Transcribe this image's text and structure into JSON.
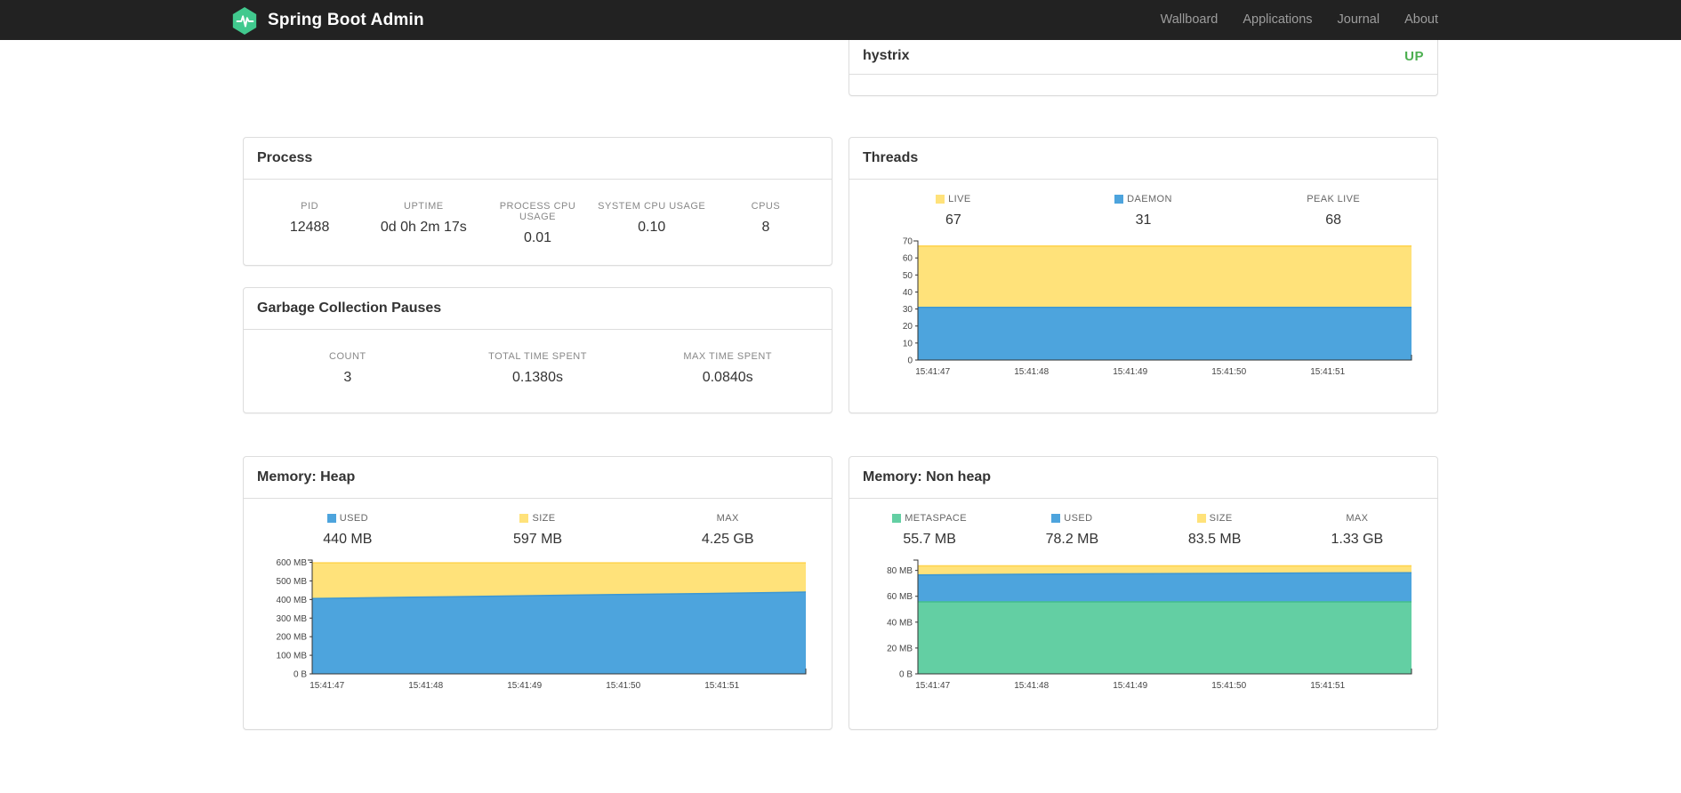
{
  "navbar": {
    "brand": "Spring Boot Admin",
    "items": [
      {
        "label": "Wallboard"
      },
      {
        "label": "Applications"
      },
      {
        "label": "Journal"
      },
      {
        "label": "About"
      }
    ]
  },
  "status_panel": {
    "row_label": "hystrix",
    "row_status": "UP"
  },
  "process": {
    "title": "Process",
    "metrics": [
      {
        "label": "PID",
        "value": "12488"
      },
      {
        "label": "UPTIME",
        "value": "0d 0h 2m 17s"
      },
      {
        "label": "PROCESS CPU USAGE",
        "value": "0.01"
      },
      {
        "label": "SYSTEM CPU USAGE",
        "value": "0.10"
      },
      {
        "label": "CPUS",
        "value": "8"
      }
    ]
  },
  "gc": {
    "title": "Garbage Collection Pauses",
    "metrics": [
      {
        "label": "COUNT",
        "value": "3"
      },
      {
        "label": "TOTAL TIME SPENT",
        "value": "0.1380s"
      },
      {
        "label": "MAX TIME SPENT",
        "value": "0.0840s"
      }
    ]
  },
  "threads": {
    "title": "Threads",
    "legend": [
      {
        "label": "LIVE",
        "value": "67",
        "color": "#FFE27A"
      },
      {
        "label": "DAEMON",
        "value": "31",
        "color": "#4DA4DD"
      },
      {
        "label": "PEAK LIVE",
        "value": "68"
      }
    ]
  },
  "memory_heap": {
    "title": "Memory: Heap",
    "legend": [
      {
        "label": "USED",
        "value": "440 MB",
        "color": "#4DA4DD"
      },
      {
        "label": "SIZE",
        "value": "597 MB",
        "color": "#FFE27A"
      },
      {
        "label": "MAX",
        "value": "4.25 GB"
      }
    ]
  },
  "memory_nonheap": {
    "title": "Memory: Non heap",
    "legend": [
      {
        "label": "METASPACE",
        "value": "55.7 MB",
        "color": "#63CFA3"
      },
      {
        "label": "USED",
        "value": "78.2 MB",
        "color": "#4DA4DD"
      },
      {
        "label": "SIZE",
        "value": "83.5 MB",
        "color": "#FFE27A"
      },
      {
        "label": "MAX",
        "value": "1.33 GB"
      }
    ]
  },
  "colors": {
    "navbar_bg": "#222222",
    "logo_green": "#41C98E",
    "status_up": "#4CAF50",
    "series_yellow": "#FFE27A",
    "series_blue": "#4DA4DD",
    "series_green": "#63CFA3"
  },
  "chart_data": [
    {
      "type": "area",
      "title": "Threads",
      "legend_position": "top",
      "x": [
        "15:41:47",
        "15:41:48",
        "15:41:49",
        "15:41:50",
        "15:41:51"
      ],
      "ylim": [
        0,
        70
      ],
      "y_ticks": [
        {
          "v": 0,
          "t": "0"
        },
        {
          "v": 10,
          "t": "10"
        },
        {
          "v": 20,
          "t": "20"
        },
        {
          "v": 30,
          "t": "30"
        },
        {
          "v": 40,
          "t": "40"
        },
        {
          "v": 50,
          "t": "50"
        },
        {
          "v": 60,
          "t": "60"
        },
        {
          "v": 70,
          "t": "70"
        }
      ],
      "series": [
        {
          "name": "LIVE",
          "color": "#FFE27A",
          "stroke": "#FFD34D",
          "values": [
            67,
            67,
            67,
            67,
            67,
            67
          ]
        },
        {
          "name": "DAEMON",
          "color": "#4DA4DD",
          "stroke": "#3C97D3",
          "values": [
            31,
            31,
            31,
            31,
            31,
            31
          ]
        }
      ]
    },
    {
      "type": "area",
      "title": "Memory: Heap",
      "legend_position": "top",
      "x": [
        "15:41:47",
        "15:41:48",
        "15:41:49",
        "15:41:50",
        "15:41:51"
      ],
      "ylim": [
        0,
        612
      ],
      "y_ticks": [
        {
          "v": 0,
          "t": "0 B"
        },
        {
          "v": 100,
          "t": "100 MB"
        },
        {
          "v": 200,
          "t": "200 MB"
        },
        {
          "v": 300,
          "t": "300 MB"
        },
        {
          "v": 400,
          "t": "400 MB"
        },
        {
          "v": 500,
          "t": "500 MB"
        },
        {
          "v": 600,
          "t": "600 MB"
        }
      ],
      "series": [
        {
          "name": "SIZE",
          "color": "#FFE27A",
          "stroke": "#FFD34D",
          "values": [
            597,
            597,
            597,
            597,
            597,
            597
          ]
        },
        {
          "name": "USED",
          "color": "#4DA4DD",
          "stroke": "#3C97D3",
          "values": [
            405,
            412,
            419,
            426,
            432,
            440
          ]
        }
      ]
    },
    {
      "type": "area",
      "title": "Memory: Non heap",
      "legend_position": "top",
      "x": [
        "15:41:47",
        "15:41:48",
        "15:41:49",
        "15:41:50",
        "15:41:51"
      ],
      "ylim": [
        0,
        88
      ],
      "y_ticks": [
        {
          "v": 0,
          "t": "0 B"
        },
        {
          "v": 20,
          "t": "20 MB"
        },
        {
          "v": 40,
          "t": "40 MB"
        },
        {
          "v": 60,
          "t": "60 MB"
        },
        {
          "v": 80,
          "t": "80 MB"
        }
      ],
      "series": [
        {
          "name": "SIZE",
          "color": "#FFE27A",
          "stroke": "#FFD34D",
          "values": [
            83.5,
            83.5,
            83.5,
            83.5,
            83.5,
            83.5
          ]
        },
        {
          "name": "USED",
          "color": "#4DA4DD",
          "stroke": "#3C97D3",
          "values": [
            76.5,
            77,
            77.4,
            77.7,
            78,
            78.2
          ]
        },
        {
          "name": "METASPACE",
          "color": "#63CFA3",
          "stroke": "#45BE8C",
          "values": [
            55.7,
            55.7,
            55.7,
            55.7,
            55.7,
            55.7
          ]
        }
      ]
    }
  ]
}
